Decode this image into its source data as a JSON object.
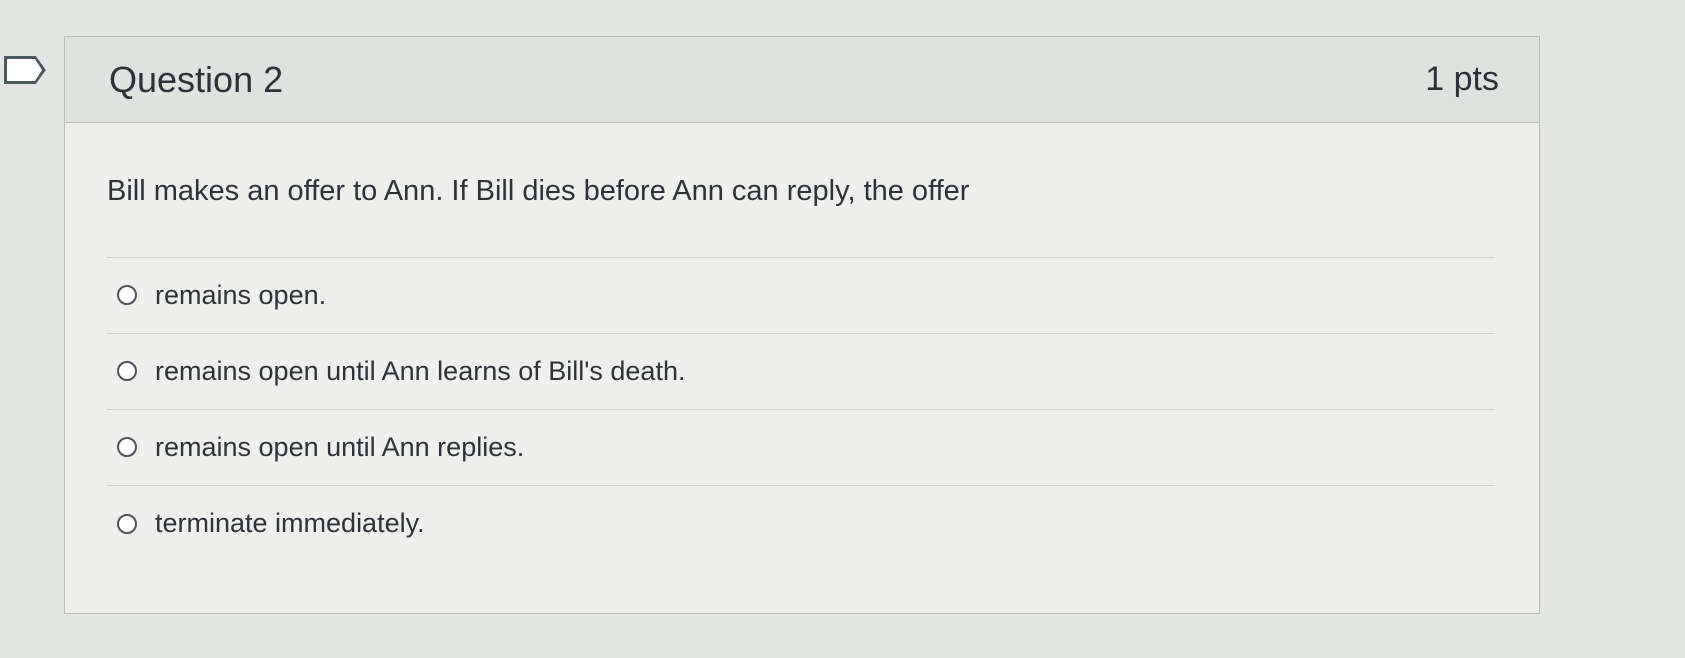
{
  "question": {
    "title": "Question 2",
    "points": "1 pts",
    "text": "Bill makes an offer to Ann. If Bill dies before Ann can reply, the offer",
    "answers": [
      {
        "label": "remains open."
      },
      {
        "label": "remains open until Ann learns of Bill's death."
      },
      {
        "label": "remains open until Ann replies."
      },
      {
        "label": "terminate immediately."
      }
    ]
  },
  "icons": {
    "flag": "flag-icon",
    "radio": "radio-button"
  }
}
